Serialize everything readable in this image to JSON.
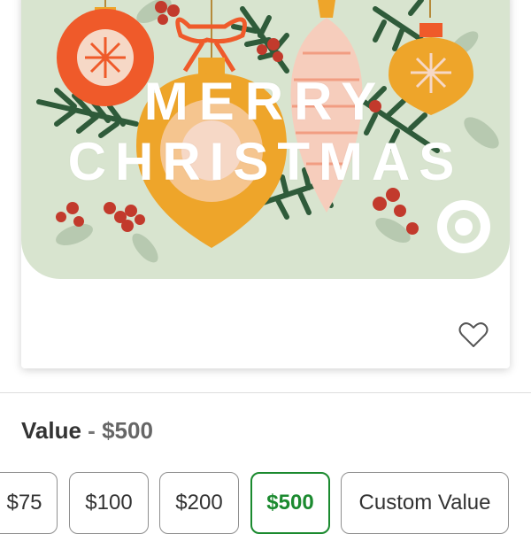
{
  "product_card": {
    "title_line1": "MERRY",
    "title_line2": "CHRISTMAS",
    "favorite_icon": "heart-outline-icon"
  },
  "value_selector": {
    "label": "Value",
    "separator": "-",
    "selected_value": "$500",
    "options": [
      "$75",
      "$100",
      "$200",
      "$500",
      "Custom Value"
    ],
    "selected_index": 3
  },
  "colors": {
    "card_background": "#d8e4cf",
    "selected_option": "#1b8a2f",
    "ornament_orange": "#ef5a2a",
    "ornament_gold": "#eea52a",
    "ornament_pink": "#f6cdbc",
    "pine_green": "#2f5b3a",
    "berry_red": "#c23a2c"
  }
}
